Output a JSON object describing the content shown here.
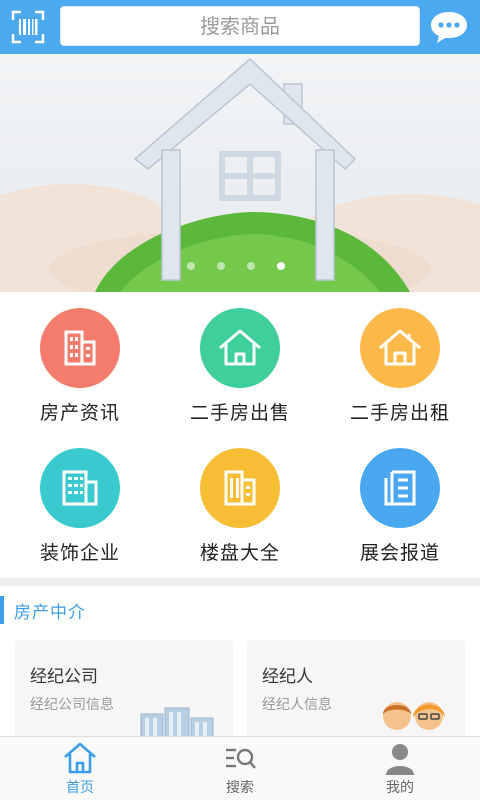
{
  "header": {
    "search_placeholder": "搜索商品",
    "scan_icon": "scan-icon",
    "chat_icon": "chat-bubble-icon",
    "bg_color": "#4ba9f0"
  },
  "banner": {
    "slide_count": 4,
    "active_index": 3
  },
  "grid": {
    "items": [
      {
        "label": "房产资讯",
        "icon": "building-icon",
        "color": "#f47c6d"
      },
      {
        "label": "二手房出售",
        "icon": "house-outline-icon",
        "color": "#3fcf9a"
      },
      {
        "label": "二手房出租",
        "icon": "house-outline-icon",
        "color": "#fbb94a"
      },
      {
        "label": "装饰企业",
        "icon": "office-building-icon",
        "color": "#39c9cf"
      },
      {
        "label": "楼盘大全",
        "icon": "tower-icon",
        "color": "#f7bd34"
      },
      {
        "label": "展会报道",
        "icon": "document-icon",
        "color": "#4aa8f0"
      }
    ]
  },
  "section": {
    "title": "房产中介"
  },
  "cards": [
    {
      "title": "经纪公司",
      "subtitle": "经纪公司信息"
    },
    {
      "title": "经纪人",
      "subtitle": "经纪人信息"
    }
  ],
  "bottom_nav": {
    "items": [
      {
        "label": "首页",
        "icon": "home-icon",
        "active": true
      },
      {
        "label": "搜索",
        "icon": "search-list-icon",
        "active": false
      },
      {
        "label": "我的",
        "icon": "user-icon",
        "active": false
      }
    ],
    "active_color": "#3d9ee8"
  }
}
